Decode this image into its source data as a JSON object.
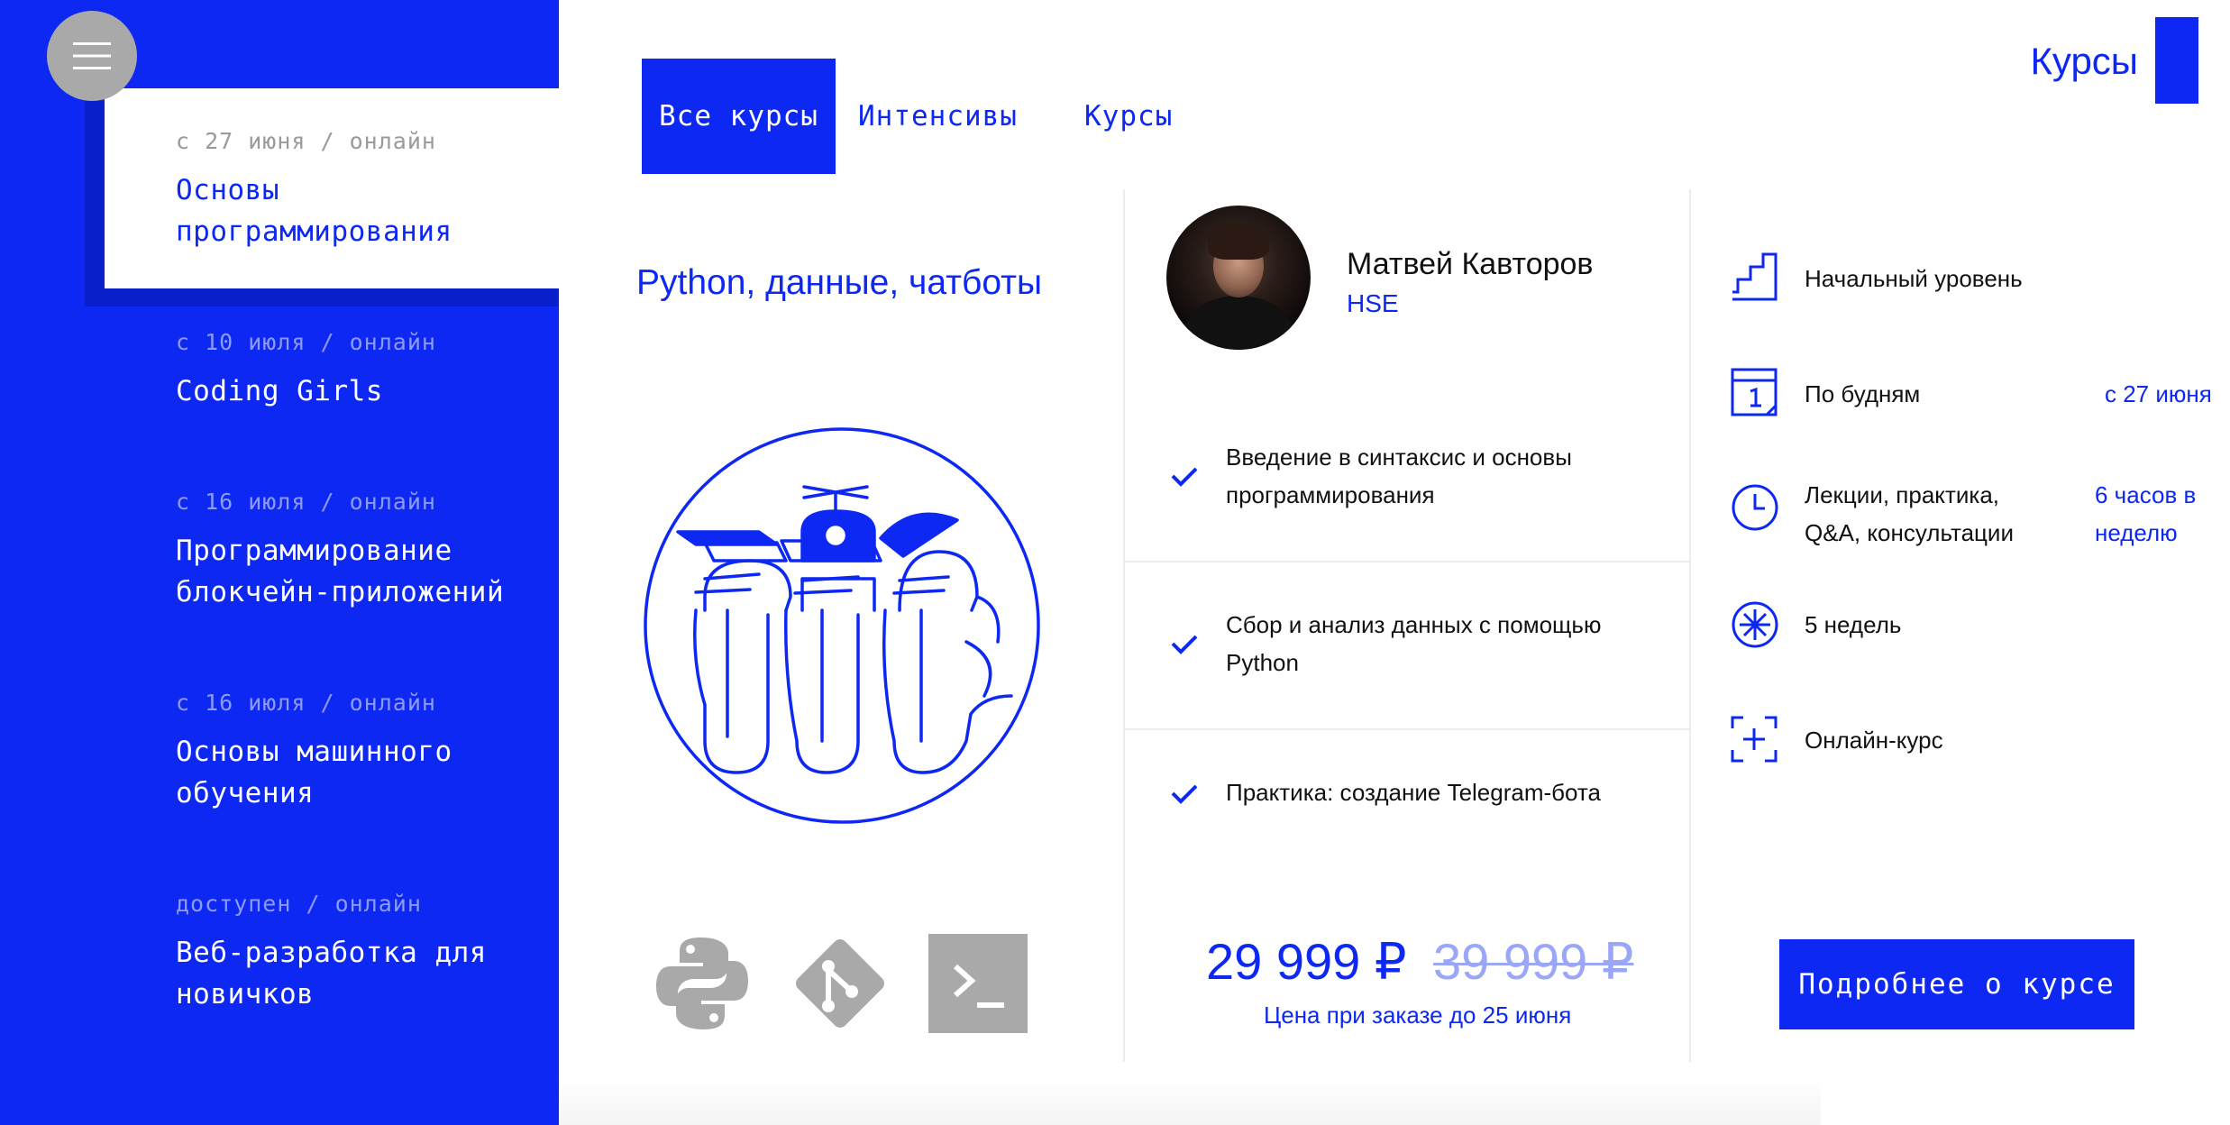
{
  "menu": {
    "icon": "hamburger-icon"
  },
  "sidebar": {
    "items": [
      {
        "date": "с 27 июня / онлайн",
        "title_line1": "Основы",
        "title_line2": "программирования"
      },
      {
        "date": "с 10 июля / онлайн",
        "title_line1": "Coding Girls",
        "title_line2": ""
      },
      {
        "date": "с 16 июля / онлайн",
        "title_line1": "Программирование",
        "title_line2": "блокчейн-приложений"
      },
      {
        "date": "с 16 июля / онлайн",
        "title_line1": "Основы машинного",
        "title_line2": "обучения"
      },
      {
        "date": "доступен / онлайн",
        "title_line1": "Веб-разработка для",
        "title_line2": "новичков"
      }
    ]
  },
  "header": {
    "title": "Курсы"
  },
  "tabs": [
    {
      "label": "Все курсы",
      "active": true
    },
    {
      "label": "Интенсивы",
      "active": false
    },
    {
      "label": "Курсы",
      "active": false
    }
  ],
  "course": {
    "title": "Python, данные, чатботы",
    "tech_icons": [
      "python-icon",
      "git-icon",
      "terminal-icon"
    ]
  },
  "teacher": {
    "name": "Матвей Кавторов",
    "org": "HSE"
  },
  "features": [
    {
      "line1": "Введение в синтаксис и основы",
      "line2": "программирования"
    },
    {
      "line1": "Сбор и анализ данных с помощью",
      "line2": "Python"
    },
    {
      "line1": "Практика: создание Telegram-бота",
      "line2": ""
    }
  ],
  "price": {
    "current": "29 999 ₽",
    "old": "39 999 ₽",
    "note": "Цена при заказе до 25 июня"
  },
  "info": [
    {
      "icon": "stairs-icon",
      "text1": "Начальный уровень",
      "text2": "",
      "value1": "",
      "value2": ""
    },
    {
      "icon": "calendar-icon",
      "text1": "По будням",
      "text2": "",
      "value1": "с 27 июня",
      "value2": ""
    },
    {
      "icon": "clock-icon",
      "text1": "Лекции, практика,",
      "text2": "Q&A, консультации",
      "value1": "6 часов в",
      "value2": "неделю"
    },
    {
      "icon": "asterisk-icon",
      "text1": "5 недель",
      "text2": "",
      "value1": "",
      "value2": ""
    },
    {
      "icon": "screen-frame-icon",
      "text1": "Онлайн-курс",
      "text2": "",
      "value1": "",
      "value2": ""
    }
  ],
  "cta": {
    "label": "Подробнее о курсе"
  },
  "colors": {
    "accent": "#0d28f2",
    "muted": "#a9a9a9"
  }
}
